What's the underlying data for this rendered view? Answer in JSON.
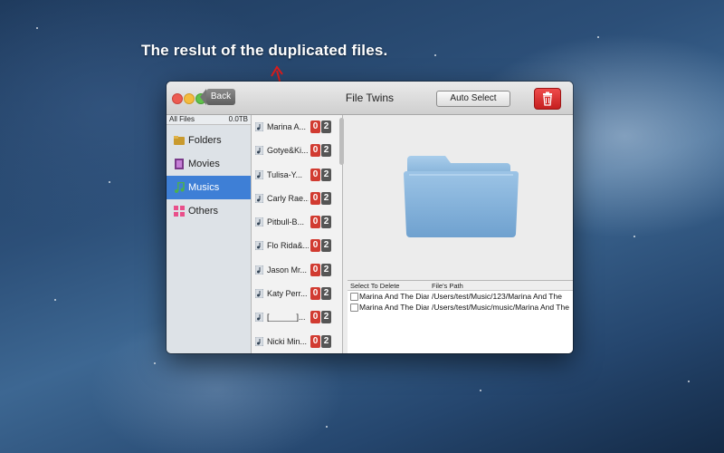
{
  "annotation": {
    "caption": "The reslut of the duplicated files."
  },
  "window": {
    "title": "File Twins",
    "back_label": "Back",
    "auto_select_label": "Auto Select"
  },
  "sidebar": {
    "all_files_label": "All Files",
    "all_files_size": "0.0TB",
    "items": [
      {
        "label": "Folders",
        "icon": "folders-icon"
      },
      {
        "label": "Movies",
        "icon": "movies-icon"
      },
      {
        "label": "Musics",
        "icon": "musics-icon",
        "selected": true
      },
      {
        "label": "Others",
        "icon": "others-icon"
      }
    ]
  },
  "files": [
    {
      "name": "Marina A...",
      "selected_count": "0",
      "duplicate_count": "2"
    },
    {
      "name": "Gotye&Ki...",
      "selected_count": "0",
      "duplicate_count": "2"
    },
    {
      "name": "Tulisa-Y...",
      "selected_count": "0",
      "duplicate_count": "2"
    },
    {
      "name": "Carly Rae...",
      "selected_count": "0",
      "duplicate_count": "2"
    },
    {
      "name": "Pitbull-B...",
      "selected_count": "0",
      "duplicate_count": "2"
    },
    {
      "name": "Flo Rida&...",
      "selected_count": "0",
      "duplicate_count": "2"
    },
    {
      "name": "Jason Mr...",
      "selected_count": "0",
      "duplicate_count": "2"
    },
    {
      "name": "Katy Perr...",
      "selected_count": "0",
      "duplicate_count": "2"
    },
    {
      "name": "[______]...",
      "selected_count": "0",
      "duplicate_count": "2"
    },
    {
      "name": "Nicki Min...",
      "selected_count": "0",
      "duplicate_count": "2"
    }
  ],
  "detail_table": {
    "headers": [
      "Select To Delete",
      "File's Path"
    ],
    "rows": [
      {
        "name": "Marina And The Diar",
        "path": "/Users/test/Music/123/Marina And The"
      },
      {
        "name": "Marina And The Diar",
        "path": "/Users/test/Music/music/Marina And The"
      }
    ]
  },
  "colors": {
    "accent": "#3e7fd6",
    "badge_red": "#d13b31",
    "badge_gray": "#555555"
  }
}
